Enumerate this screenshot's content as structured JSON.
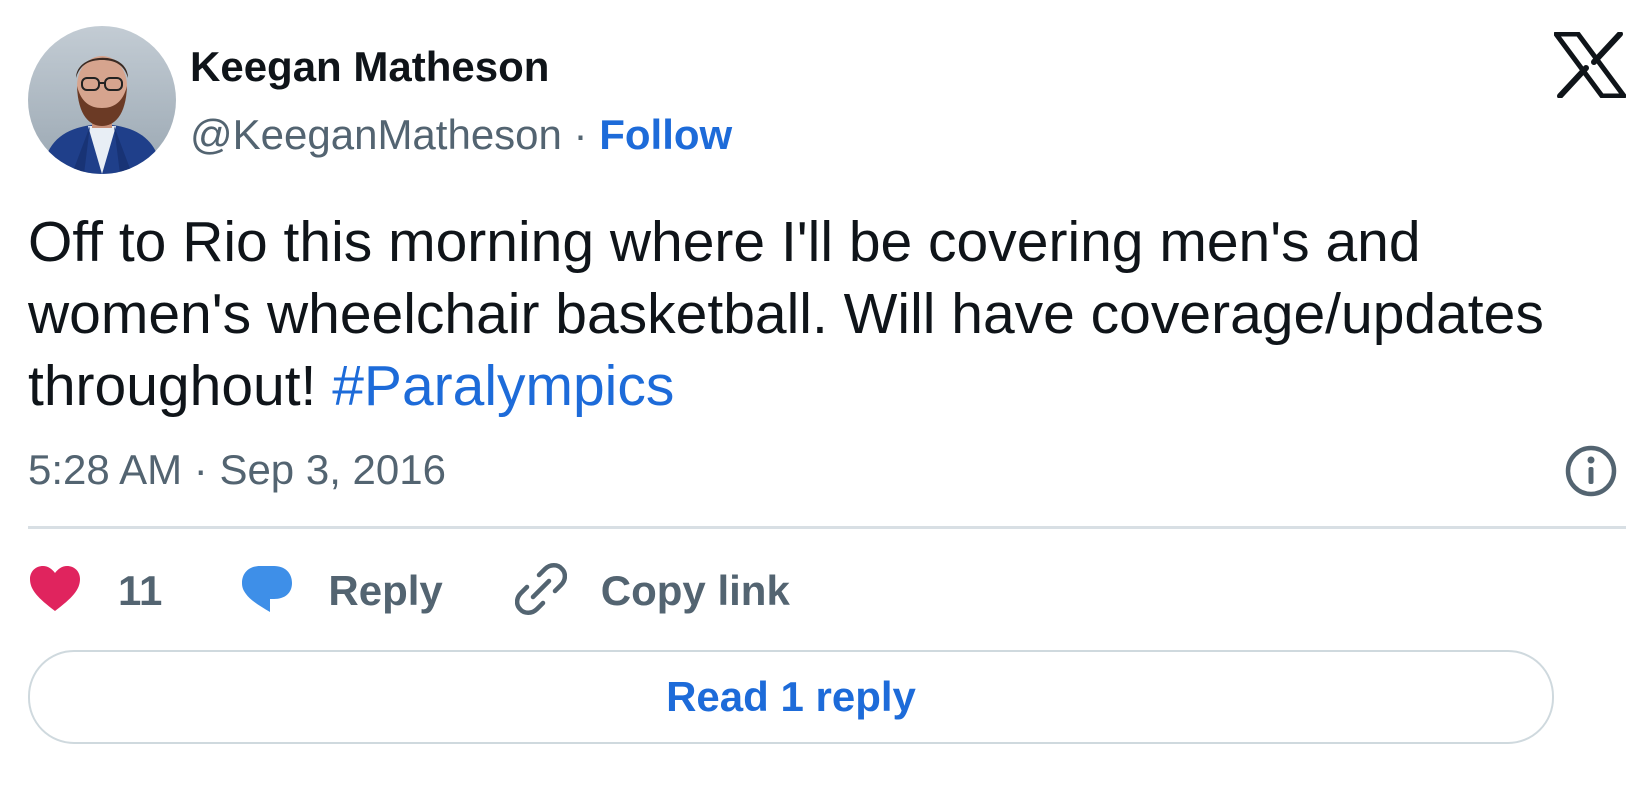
{
  "author": {
    "name": "Keegan Matheson",
    "handle": "@KeeganMatheson",
    "separator": " · ",
    "follow_label": "Follow"
  },
  "tweet": {
    "text": "Off to Rio this morning where I'll be covering men's and women's wheelchair basketball. Will have coverage/updates throughout! ",
    "hashtag": "#Paralympics",
    "time": "5:28 AM",
    "time_separator": " · ",
    "date": "Sep 3, 2016"
  },
  "actions": {
    "likes_count": "11",
    "reply_label": "Reply",
    "copy_link_label": "Copy link"
  },
  "read_replies_label": "Read 1 reply",
  "icons": {
    "brand": "x-logo-icon",
    "info": "info-icon",
    "like": "heart-icon",
    "reply": "speech-bubble-icon",
    "copy": "link-icon"
  },
  "colors": {
    "link": "#1d6bd9",
    "secondary_text": "#536471",
    "like": "#e0245e",
    "reply": "#3e8fe8",
    "divider": "#d8dfe4"
  }
}
